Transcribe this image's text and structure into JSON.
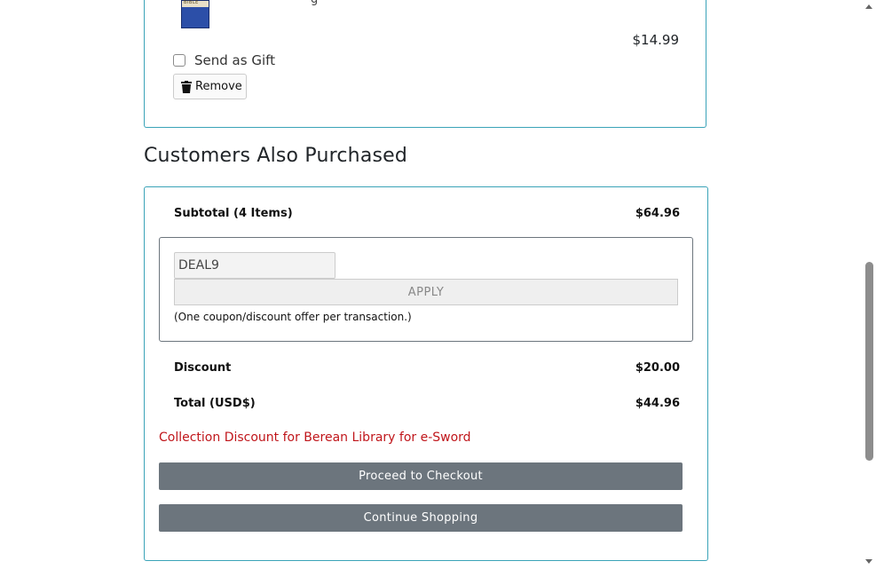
{
  "cart_item": {
    "thumb_text": "BIBLE",
    "title_fragment": "g",
    "price": "$14.99",
    "gift_label": "Send as Gift",
    "remove_label": "Remove"
  },
  "section_title": "Customers Also Purchased",
  "summary": {
    "subtotal_label": "Subtotal (4 Items)",
    "subtotal_value": "$64.96",
    "coupon_value": "DEAL9",
    "apply_label": "APPLY",
    "coupon_note": "(One coupon/discount offer per transaction.)",
    "discount_label": "Discount",
    "discount_value": "$20.00",
    "total_label": "Total (USD$)",
    "total_value": "$44.96",
    "discount_message": "Collection Discount for Berean Library for e-Sword",
    "checkout_label": "Proceed to Checkout",
    "continue_label": "Continue Shopping"
  },
  "colors": {
    "card_border": "#3aa3b8",
    "button_gray": "#6c757d",
    "discount_red": "#c0161b"
  }
}
